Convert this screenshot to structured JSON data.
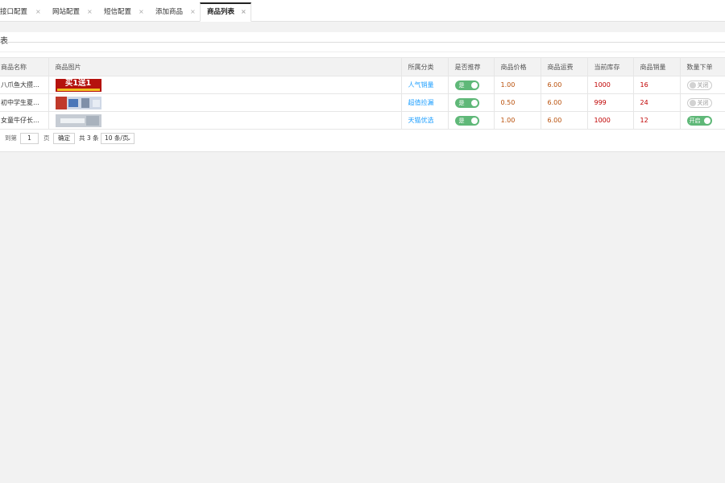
{
  "tabs": [
    {
      "label": "接口配置",
      "close": "×",
      "active": false
    },
    {
      "label": "网站配置",
      "close": "×",
      "active": false
    },
    {
      "label": "短信配置",
      "close": "×",
      "active": false
    },
    {
      "label": "添加商品",
      "close": "×",
      "active": false
    },
    {
      "label": "商品列表",
      "close": "×",
      "active": true
    }
  ],
  "page": {
    "title": "表"
  },
  "table": {
    "headers": [
      "商品名称",
      "商品图片",
      "所属分类",
      "是否推荐",
      "商品价格",
      "商品运费",
      "当前库存",
      "商品销量",
      "数量下单"
    ],
    "rows": [
      {
        "name": "八爪鱼大攒…",
        "image_text": "买1送1",
        "category": "人气销量",
        "recommend": "是",
        "price": "1.00",
        "shipping": "6.00",
        "stock": "1000",
        "sales": "16",
        "qty_order": "关闭",
        "qty_on": false
      },
      {
        "name": "初中学生夏…",
        "image_text": "",
        "category": "超值捡漏",
        "recommend": "是",
        "price": "0.50",
        "shipping": "6.00",
        "stock": "999",
        "sales": "24",
        "qty_order": "关闭",
        "qty_on": false
      },
      {
        "name": "女童牛仔长…",
        "image_text": "",
        "category": "天猫优选",
        "recommend": "是",
        "price": "1.00",
        "shipping": "6.00",
        "stock": "1000",
        "sales": "12",
        "qty_order": "开启",
        "qty_on": true
      }
    ]
  },
  "pager": {
    "goto_label": "到第",
    "page_value": "1",
    "page_unit": "页",
    "confirm_label": "确定",
    "total_label": "共 3 条",
    "per_page": "10 条/页"
  },
  "colors": {
    "switch_on": "#5fb878",
    "category": "#1e9fff",
    "price": "#b84e08",
    "stock": "#c00000"
  }
}
